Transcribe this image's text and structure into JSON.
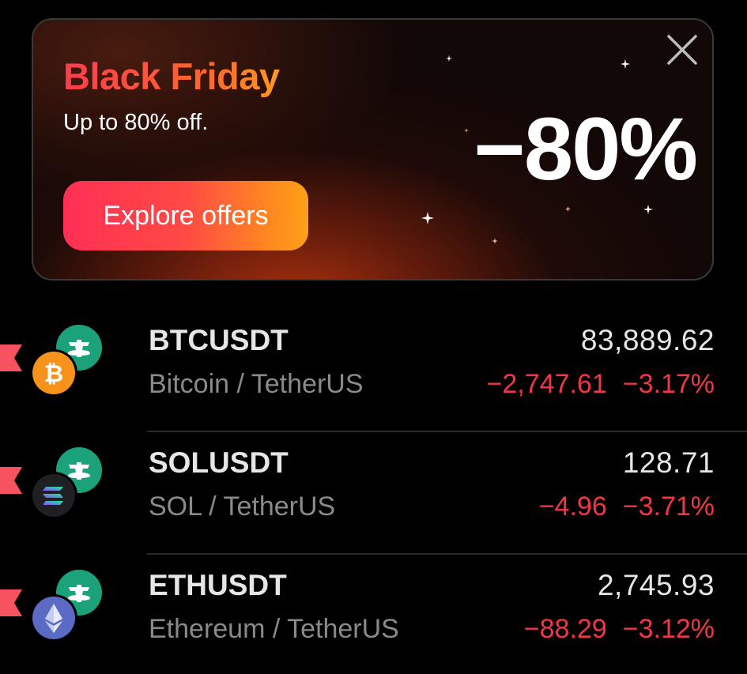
{
  "banner": {
    "title": "Black Friday",
    "subtitle": "Up to 80% off.",
    "cta_label": "Explore offers",
    "discount": "−80%",
    "title_gradient": [
      "#ff3b4e",
      "#ff9a1e"
    ],
    "cta_gradient": [
      "#ff2f55",
      "#ffa018"
    ]
  },
  "tickers": [
    {
      "symbol": "BTCUSDT",
      "name": "Bitcoin / TetherUS",
      "price": "83,889.62",
      "change": "−2,747.61",
      "change_pct": "−3.17%",
      "coin_icon": "bitcoin-icon",
      "quote_icon": "tether-icon"
    },
    {
      "symbol": "SOLUSDT",
      "name": "SOL / TetherUS",
      "price": "128.71",
      "change": "−4.96",
      "change_pct": "−3.71%",
      "coin_icon": "solana-icon",
      "quote_icon": "tether-icon"
    },
    {
      "symbol": "ETHUSDT",
      "name": "Ethereum / TetherUS",
      "price": "2,745.93",
      "change": "−88.29",
      "change_pct": "−3.12%",
      "coin_icon": "ethereum-icon",
      "quote_icon": "tether-icon"
    }
  ],
  "colors": {
    "negative": "#f23645",
    "flag": "#f7525f",
    "tether": "#1ba27a",
    "bitcoin": "#f7931a",
    "solana_bg": "#1f1f24",
    "ethereum_bg": "#5b6bc4"
  }
}
